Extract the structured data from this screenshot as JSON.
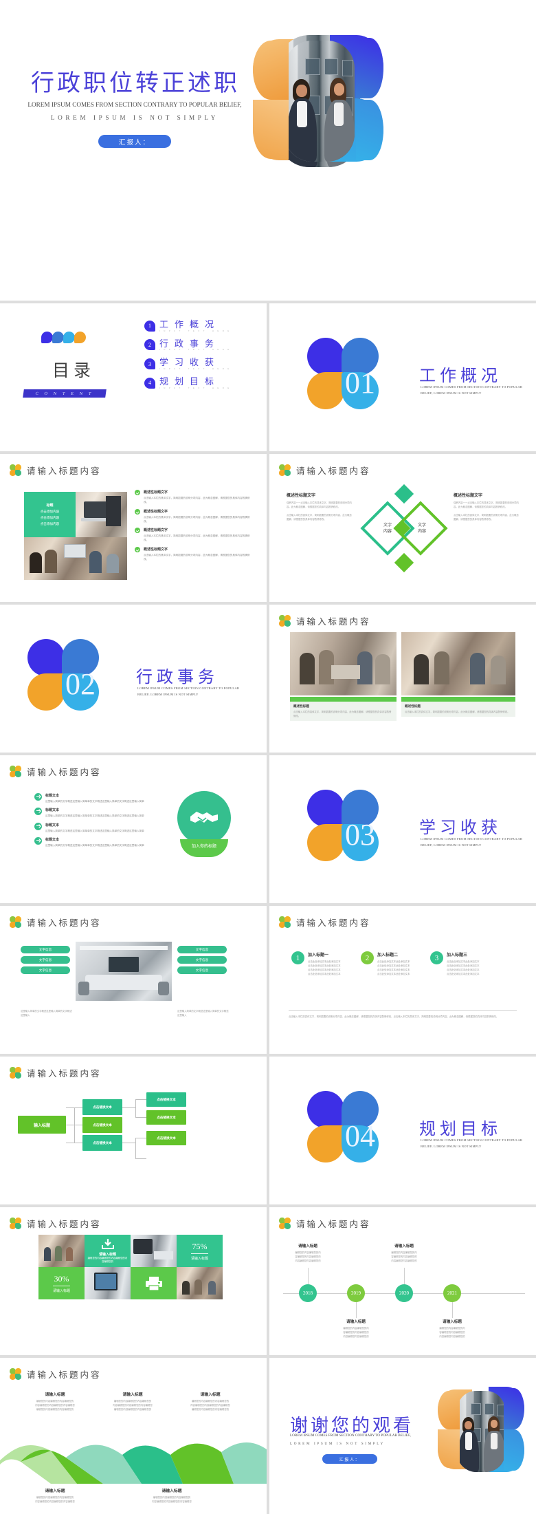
{
  "meta": {
    "accent_blue": "#4b41d8",
    "accent_green": "#5cc94a",
    "accent_teal": "#33c48f",
    "accent_orange": "#f2a32a"
  },
  "hero": {
    "title": "行政职位转正述职",
    "subtitle_line1": "LOREM IPSUM COMES FROM SECTION CONTRARY TO POPULAR BELIEF,",
    "subtitle_line2": "LOREM IPSUM IS NOT SIMPLY",
    "presenter_label": "汇报人："
  },
  "toc": {
    "heading": "目录",
    "heading_en": "C O N T E N T",
    "items": [
      {
        "num": "1",
        "title": "工作概况",
        "sub": "INPUT TEXT HERE"
      },
      {
        "num": "2",
        "title": "行政事务",
        "sub": "INPUT TEXT HERE"
      },
      {
        "num": "3",
        "title": "学习收获",
        "sub": "INPUT TEXT HERE"
      },
      {
        "num": "4",
        "title": "规划目标",
        "sub": "INPUT TEXT HERE"
      }
    ]
  },
  "sections": [
    {
      "num": "01",
      "title": "工作概况",
      "desc": "LOREM IPSUM COMES FROM SECTION CONTRARY TO POPULAR BELIEF, LOREM IPSUM IS NOT SIMPLY"
    },
    {
      "num": "02",
      "title": "行政事务",
      "desc": "LOREM IPSUM COMES FROM SECTION CONTRARY TO POPULAR BELIEF, LOREM IPSUM IS NOT SIMPLY"
    },
    {
      "num": "03",
      "title": "学习收获",
      "desc": "LOREM IPSUM COMES FROM SECTION CONTRARY TO POPULAR BELIEF, LOREM IPSUM IS NOT SIMPLY"
    },
    {
      "num": "04",
      "title": "规划目标",
      "desc": "LOREM IPSUM COMES FROM SECTION CONTRARY TO POPULAR BELIEF, LOREM IPSUM IS NOT SIMPLY"
    }
  ],
  "common": {
    "slide_title": "请输入标题内容"
  },
  "slide_image_bullets": {
    "card_title": "标题",
    "card_lines": [
      "点击添加内容",
      "点击添加内容",
      "点击添加内容"
    ],
    "bullets": [
      {
        "title": "概述性标题文字",
        "body": "点击输入本栏的具体文字，简明扼要的说明分项内容，此为概念图解，请根据您的具体内容酌情修改。"
      },
      {
        "title": "概述性标题文字",
        "body": "点击输入本栏的具体文字，简明扼要的说明分项内容，此为概念图解，请根据您的具体内容酌情修改。"
      },
      {
        "title": "概述性标题文字",
        "body": "点击输入本栏的具体文字，简明扼要的说明分项内容，此为概念图解，请根据您的具体内容酌情修改。"
      },
      {
        "title": "概述性标题文字",
        "body": "点击输入本栏的具体文字，简明扼要的说明分项内容，此为概念图解，请根据您的具体内容酌情修改。"
      }
    ]
  },
  "slide_diamond": {
    "left": {
      "title": "概述性标题文字",
      "p1": "保罗内容一一点击输入本栏的具体文字，简明扼要的说明分项内容，此为概念图解，请根据您的具体内容酌情修改。",
      "p2": "点击输入本栏的具体文字，简明扼要的说明分项内容，此为概念图解，请根据您的具体内容酌情修改。"
    },
    "right": {
      "title": "概述性标题文字",
      "p1": "保罗内容一一点击输入本栏的具体文字，简明扼要的说明分项内容，此为概念图解，请根据您的具体内容酌情修改。",
      "p2": "点击输入本栏的具体文字，简明扼要的说明分项内容，此为概念图解，请根据您的具体内容酌情修改。"
    },
    "diamond_left_label": "文字\n内容",
    "diamond_right_label": "文字\n内容"
  },
  "slide_two_photos": {
    "caption_left_title": "概述性标题",
    "caption_left_body": "点击输入本栏的具体文字，简明扼要的说明分项内容，此为概念图解，请根据您的具体内容酌情修改。",
    "caption_right_title": "概述性标题",
    "caption_right_body": "点击输入本栏的具体文字，简明扼要的说明分项内容，此为概念图解，请根据您的具体内容酌情修改。"
  },
  "slide_arrows": {
    "items": [
      {
        "title": "标题文本",
        "body": "这里输入简单的文字概述这里输入简单单的文字概述这里输入简单的文字概述这里输入简单"
      },
      {
        "title": "标题文本",
        "body": "这里输入简单的文字概述这里输入简单单的文字概述这里输入简单的文字概述这里输入简单"
      },
      {
        "title": "标题文本",
        "body": "这里输入简单的文字概述这里输入简单单的文字概述这里输入简单的文字概述这里输入简单"
      },
      {
        "title": "标题文本",
        "body": "这里输入简单的文字概述这里输入简单单的文字概述这里输入简单的文字概述这里输入简单"
      }
    ],
    "badge": "加入你的标题",
    "icon": "handshake-icon"
  },
  "slide_room": {
    "tags_left": [
      "文字信息",
      "文字信息",
      "文字信息"
    ],
    "tags_right": [
      "文字信息",
      "文字信息",
      "文字信息"
    ],
    "body_left": "这里输入简单的文字概述这里输入简单的文字概述这里输入",
    "body_right": "这里输入简单的文字概述这里输入简单的文字概述这里输入"
  },
  "slide_numbered": {
    "items": [
      {
        "num": "1",
        "title": "加入标题一",
        "body": "点击此处添加文本此处添加文本\n点击此处添加文本此处添加文本\n点击此处添加文本此处添加文本\n点击此处添加文本此处添加文本",
        "color": "#33c48f"
      },
      {
        "num": "2",
        "title": "加入标题二",
        "body": "点击此处添加文本此处添加文本\n点击此处添加文本此处添加文本\n点击此处添加文本此处添加文本\n点击此处添加文本此处添加文本",
        "color": "#7ecb3e"
      },
      {
        "num": "3",
        "title": "加入标题三",
        "body": "点击此处添加文本此处添加文本\n点击此处添加文本此处添加文本\n点击此处添加文本此处添加文本\n点击此处添加文本此处添加文本",
        "color": "#33c48f"
      }
    ],
    "footer": "点击输入本栏的具体文字，简明扼要的说明分项内容，此为概念图解，请根据您的具体内容酌情修改。点击输入本栏的具体文字，简明扼要的说明分项内容，此为概念图解，请根据您的具体内容酌情修改。"
  },
  "slide_orgchart": {
    "root": "输入标题",
    "nodes": [
      "点击替换文本",
      "点击替换文本",
      "点击替换文本",
      "点击替换文本",
      "点击替换文本",
      "点击替换文本"
    ]
  },
  "slide_mosaic": {
    "tile_download_title": "请输入标题",
    "tile_download_body": "编辑您的内容编辑您的内容编辑您的内容编辑您的",
    "stat1_value": "75%",
    "stat1_label": "请输入标题",
    "stat2_value": "30%",
    "stat2_label": "请输入标题",
    "icons": [
      "download-icon",
      "printer-icon"
    ]
  },
  "slide_timeline": {
    "top_items": [
      {
        "title": "请输入标题",
        "body": "编辑您的内容编辑您的内\n容编辑您的内容编辑您的\n内容编辑您内容编辑您的"
      },
      {
        "title": "请输入标题",
        "body": "编辑您的内容编辑您的内\n容编辑您的内容编辑您的\n内容编辑您内容编辑您的"
      }
    ],
    "bottom_items": [
      {
        "title": "请输入标题",
        "body": "编辑您的内容编辑您的内\n容编辑您的内容编辑您的\n内容编辑您内容编辑您的"
      },
      {
        "title": "请输入标题",
        "body": "编辑您的内容编辑您的内\n容编辑您的内容编辑您的\n内容编辑您内容编辑您的"
      }
    ],
    "years": [
      "2018",
      "2019",
      "2020",
      "2021"
    ]
  },
  "slide_ribbon": {
    "top_items": [
      {
        "title": "请输入标题",
        "body": "编辑您的内容编辑您的内容编辑您的\n内容编辑您的内容编辑您的内容编辑您\n编辑您的内容编辑您的内容编辑您的"
      },
      {
        "title": "请输入标题",
        "body": "编辑您的内容编辑您的内容编辑您的\n内容编辑您的内容编辑您的内容编辑您\n编辑您的内容编辑您的内容编辑您的"
      },
      {
        "title": "请输入标题",
        "body": "编辑您的内容编辑您的内容编辑您的\n内容编辑您的内容编辑您的内容编辑您\n编辑您的内容编辑您的内容编辑您的"
      }
    ],
    "bottom_items": [
      {
        "title": "请输入标题",
        "body": "编辑您的内容编辑您的内容编辑您的\n内容编辑您的内容编辑您的内容编辑您"
      },
      {
        "title": "请输入标题",
        "body": "编辑您的内容编辑您的内容编辑您的\n内容编辑您的内容编辑您的内容编辑您"
      }
    ]
  },
  "thanks": {
    "title": "谢谢您的观看",
    "subtitle_line1": "LOREM IPSUM COMES FROM SECTION CONTRARY TO POPULAR BELIEF,",
    "subtitle_line2": "LOREM IPSUM IS NOT SIMPLY",
    "presenter_label": "汇报人："
  }
}
